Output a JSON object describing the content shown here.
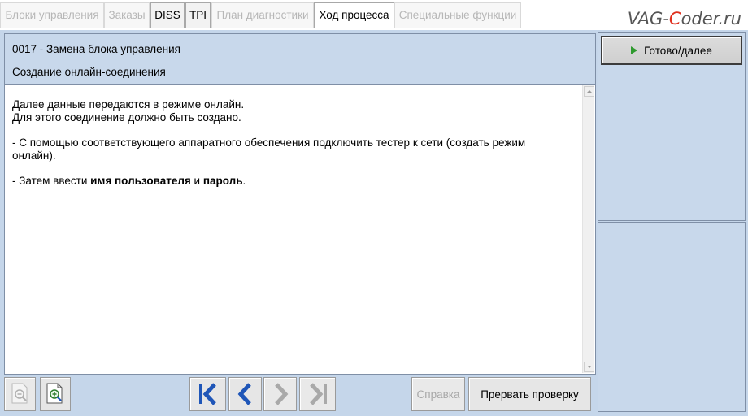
{
  "tabs": [
    {
      "label": "Блоки управления",
      "state": "disabled"
    },
    {
      "label": "Заказы",
      "state": "disabled"
    },
    {
      "label": "DISS",
      "state": "enabled"
    },
    {
      "label": "TPI",
      "state": "enabled"
    },
    {
      "label": "План диагностики",
      "state": "disabled"
    },
    {
      "label": "Ход процесса",
      "state": "active"
    },
    {
      "label": "Специальные функции",
      "state": "disabled"
    }
  ],
  "watermark": {
    "prefix": "VAG-",
    "accent": "C",
    "suffix": "oder.ru"
  },
  "header": {
    "procedure": "0017 - Замена блока управления",
    "step": "Создание онлайн-соединения"
  },
  "content": {
    "line1": "Далее данные передаются в режиме онлайн.",
    "line2": "Для этого соединение должно быть создано.",
    "line3": "- С помощью соответствующего аппаратного обеспечения подключить тестер к сети (создать режим",
    "line4": "онлайн).",
    "line5_prefix": "- Затем ввести ",
    "line5_bold1": "имя пользователя",
    "line5_mid": " и ",
    "line5_bold2": "пароль",
    "line5_suffix": "."
  },
  "side": {
    "ready_label": "Готово/далее"
  },
  "toolbar": {
    "help_label": "Справка",
    "abort_label": "Прервать проверку"
  },
  "colors": {
    "background": "#c5d6ea",
    "accent_green": "#2f9a2f",
    "nav_blue": "#1f56b8",
    "watermark_red": "#e0301e"
  }
}
